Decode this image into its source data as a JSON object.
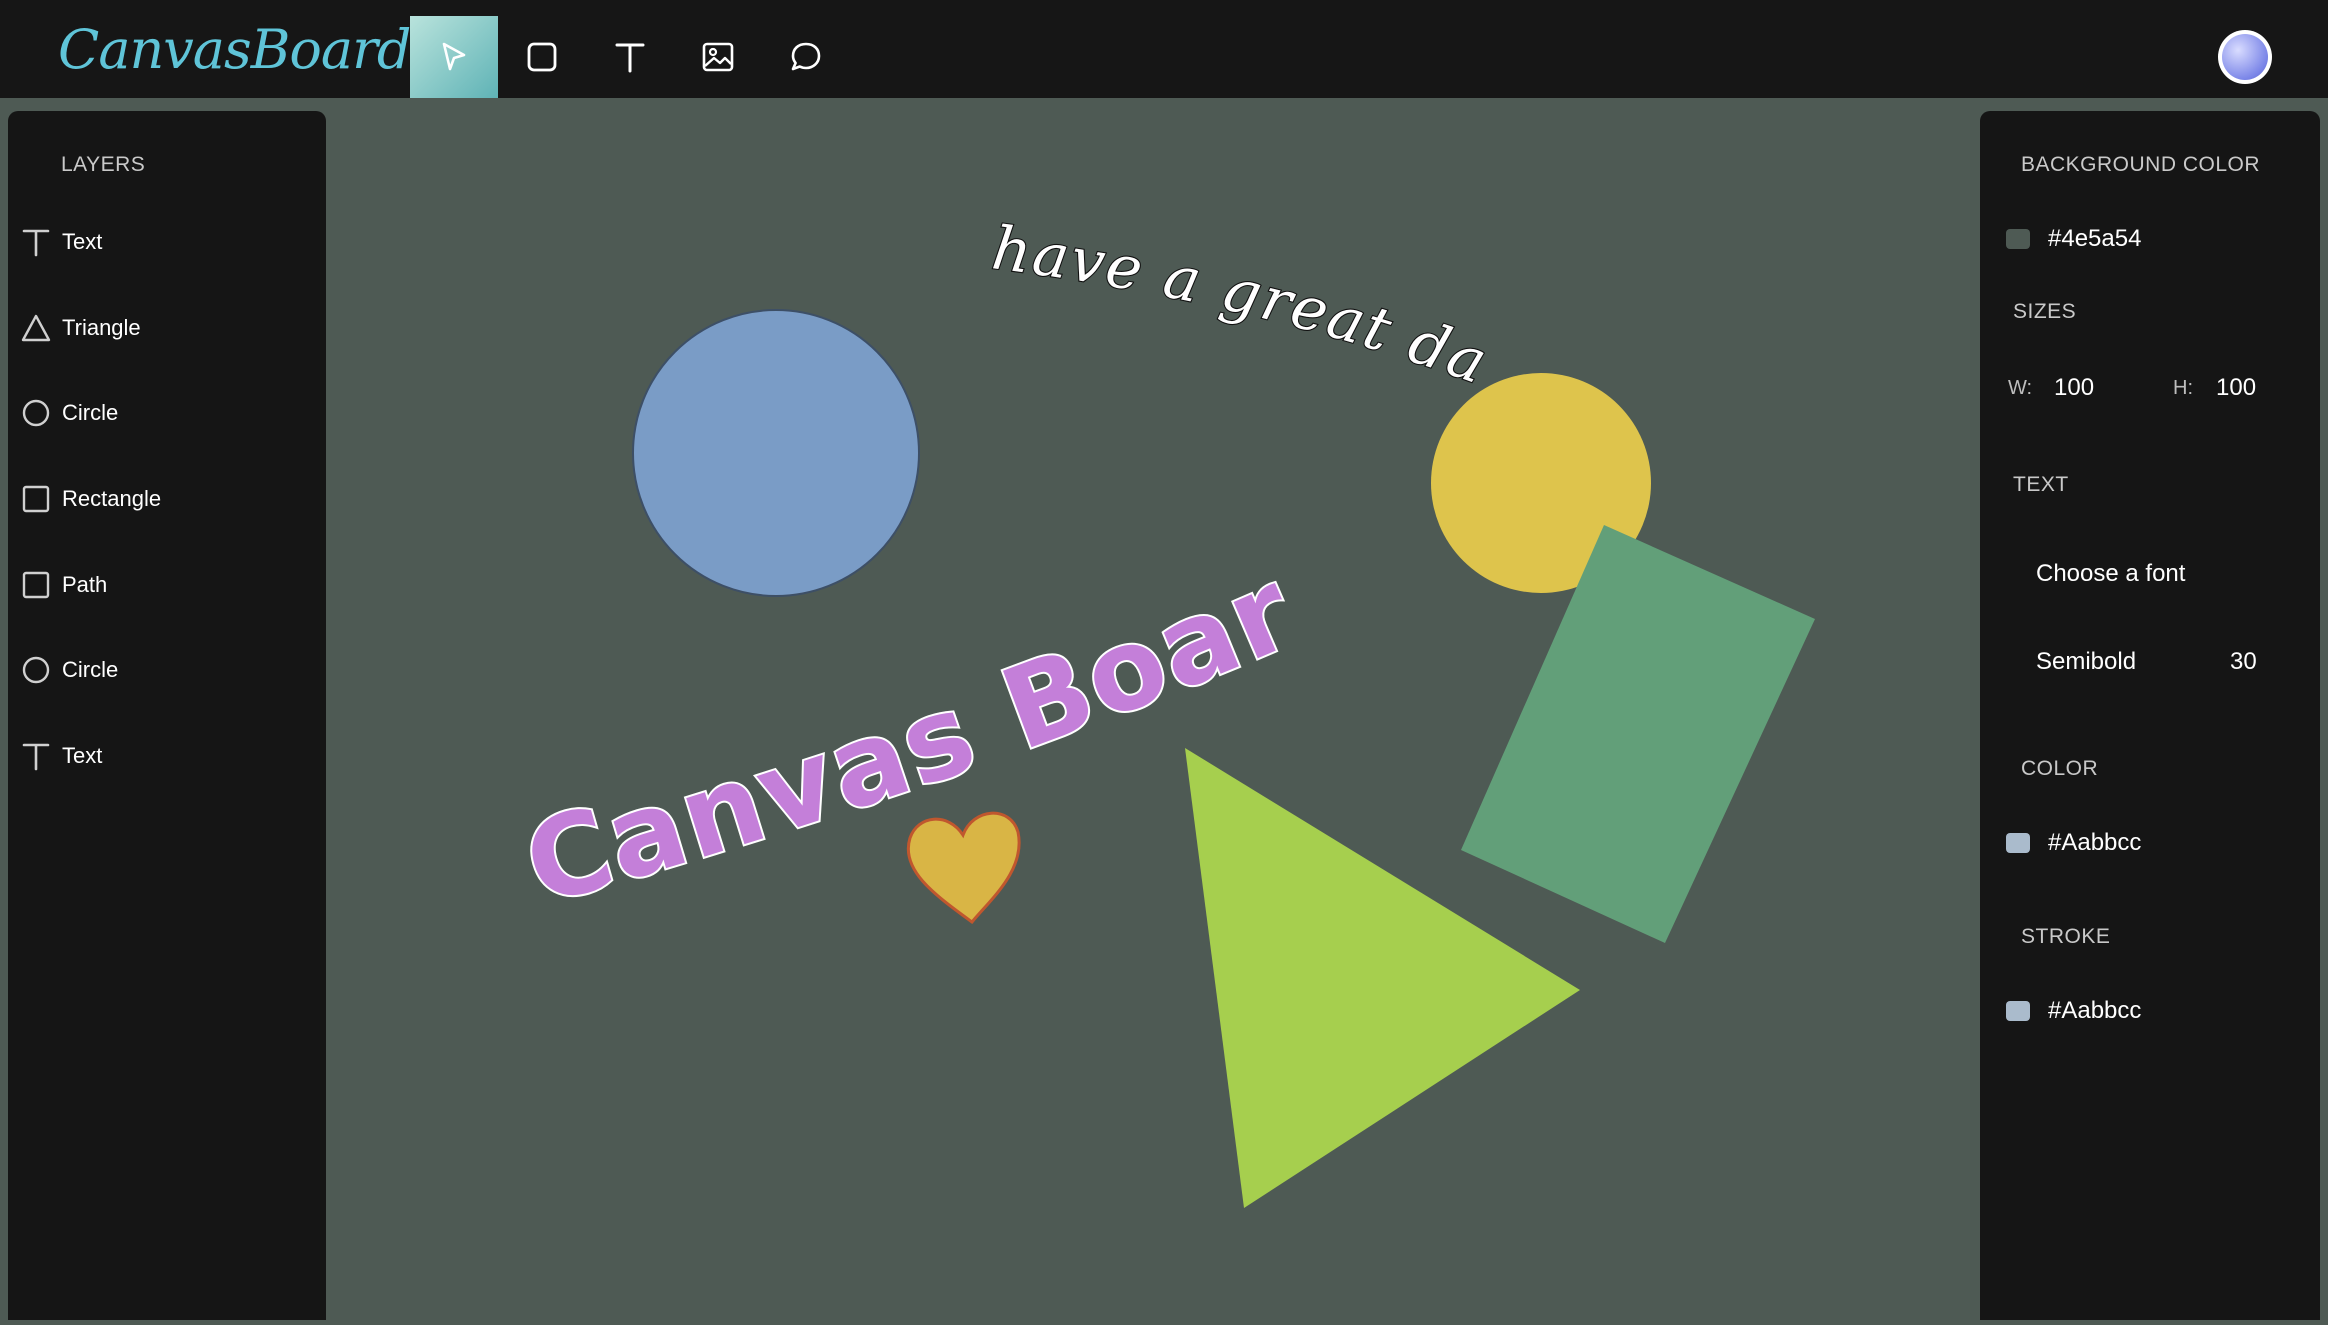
{
  "app": {
    "logo": "CanvasBoard"
  },
  "toolbar": {
    "tools": [
      {
        "name": "select",
        "icon": "cursor-icon",
        "active": true
      },
      {
        "name": "shape",
        "icon": "square-icon"
      },
      {
        "name": "text",
        "icon": "text-icon"
      },
      {
        "name": "image",
        "icon": "image-icon"
      },
      {
        "name": "comment",
        "icon": "comment-icon"
      }
    ]
  },
  "layers": {
    "heading": "LAYERS",
    "items": [
      {
        "label": "Text",
        "icon": "text-icon"
      },
      {
        "label": "Triangle",
        "icon": "triangle-icon"
      },
      {
        "label": "Circle",
        "icon": "circle-icon"
      },
      {
        "label": "Rectangle",
        "icon": "square-icon"
      },
      {
        "label": "Path",
        "icon": "square-icon"
      },
      {
        "label": "Circle",
        "icon": "circle-icon"
      },
      {
        "label": "Text",
        "icon": "text-icon"
      }
    ]
  },
  "canvas": {
    "background": "#4e5a54",
    "curved_text_top": "have a great day",
    "curved_text_main": "Canvas Board!",
    "colors": {
      "blue_circle": "#7a9cc6",
      "yellow_circle": "#dec44c",
      "green_rect": "#629f79",
      "lime_triangle": "#a6cf4e",
      "heart_fill": "#d9b545",
      "heart_stroke": "#c0572e",
      "main_text": "#c47fd9"
    }
  },
  "properties": {
    "background_heading": "BACKGROUND COLOR",
    "background_value": "#4e5a54",
    "sizes_heading": "SIZES",
    "width_label": "W:",
    "width_value": "100",
    "height_label": "H:",
    "height_value": "100",
    "text_heading": "TEXT",
    "font_placeholder": "Choose a font",
    "font_weight": "Semibold",
    "font_size": "30",
    "color_heading": "COLOR",
    "color_value": "#Aabbcc",
    "color_swatch": "#aabbcc",
    "stroke_heading": "STROKE",
    "stroke_value": "#Aabbcc",
    "stroke_swatch": "#aabbcc"
  }
}
